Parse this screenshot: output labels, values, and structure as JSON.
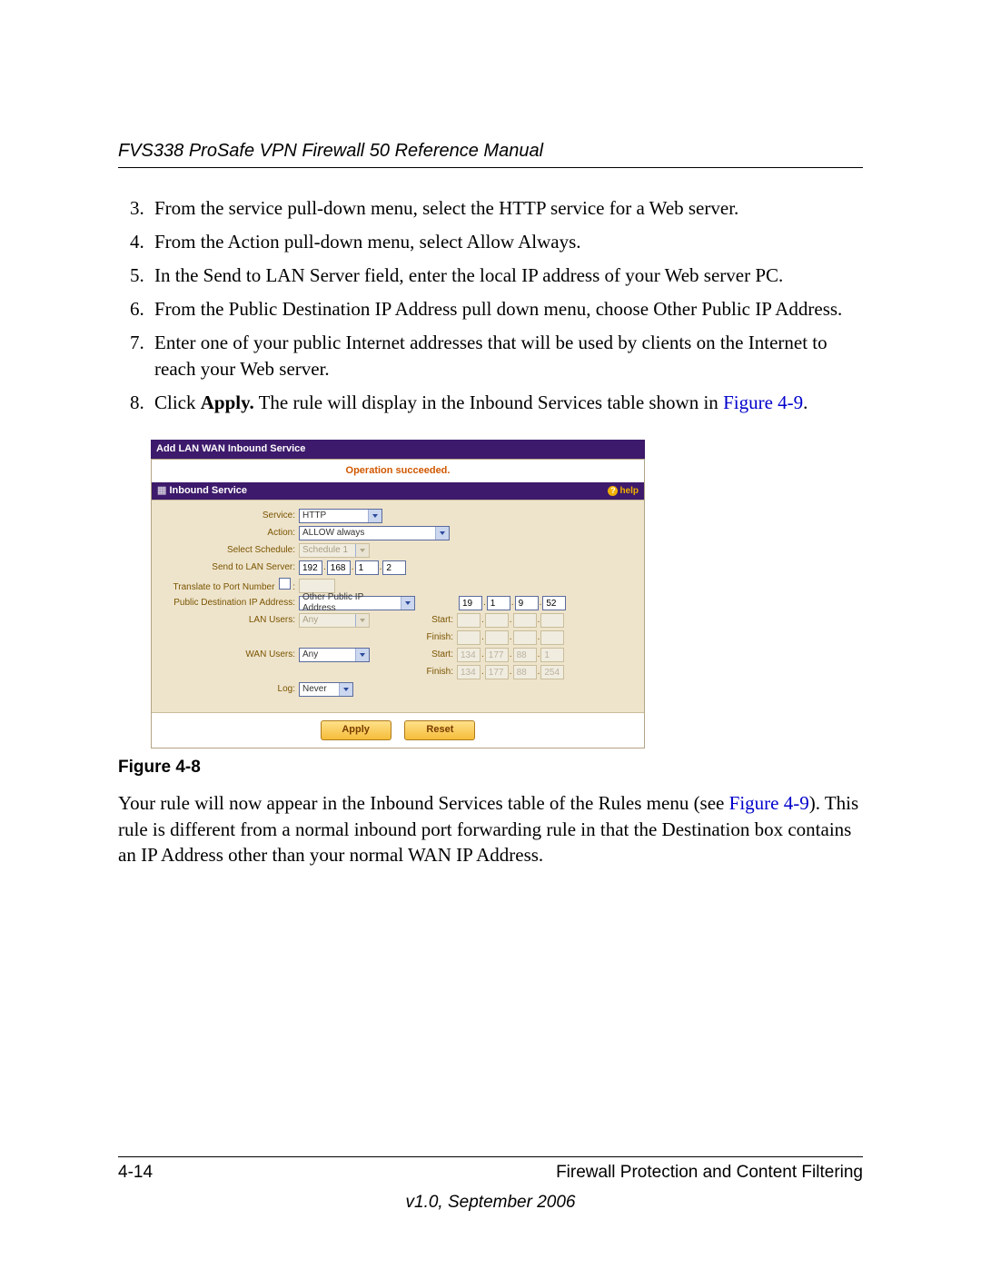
{
  "header": {
    "title": "FVS338 ProSafe VPN Firewall 50 Reference Manual"
  },
  "steps_start": 3,
  "steps": [
    {
      "text": "From the service pull-down menu, select the HTTP service for a Web server."
    },
    {
      "text": "From the Action pull-down menu, select Allow Always."
    },
    {
      "text": "In the Send to LAN Server field, enter the local IP address of your Web server PC."
    },
    {
      "text": "From the Public Destination IP Address pull down menu, choose Other Public IP Address."
    },
    {
      "text": "Enter one of your public Internet addresses that will be used by clients on the Internet to reach your Web server."
    },
    {
      "pre": "Click ",
      "bold": "Apply.",
      "post": " The rule will display in the Inbound Services table shown in ",
      "link": "Figure 4-9",
      "post2": "."
    }
  ],
  "panel": {
    "title": "Add LAN WAN Inbound Service",
    "success": "Operation succeeded.",
    "section": "Inbound Service",
    "help": "help",
    "labels": {
      "service": "Service:",
      "action": "Action:",
      "schedule": "Select Schedule:",
      "sendto": "Send to LAN Server:",
      "translate": "Translate to Port Number",
      "pubdest": "Public Destination IP Address:",
      "lanusers": "LAN Users:",
      "wanusers": "WAN Users:",
      "log": "Log:",
      "start": "Start:",
      "finish": "Finish:"
    },
    "values": {
      "service": "HTTP",
      "action": "ALLOW always",
      "schedule": "Schedule 1",
      "sendto": [
        "192",
        "168",
        "1",
        "2"
      ],
      "translate": "",
      "pubdest": "Other Public IP Address",
      "pubdest_ip": [
        "19",
        "1",
        "9",
        "52"
      ],
      "lanusers": "Any",
      "lan_start": [
        "",
        "",
        "",
        ""
      ],
      "lan_finish": [
        "",
        "",
        "",
        ""
      ],
      "wanusers": "Any",
      "wan_start": [
        "134",
        "177",
        "88",
        "1"
      ],
      "wan_finish": [
        "134",
        "177",
        "88",
        "254"
      ],
      "log": "Never"
    },
    "buttons": {
      "apply": "Apply",
      "reset": "Reset"
    }
  },
  "figure_caption": "Figure 4-8",
  "para": {
    "pre": "Your rule will now appear in the Inbound Services table of the Rules menu (see ",
    "link": "Figure 4-9",
    "post": "). This rule is different from a normal inbound port forwarding rule in that the Destination box contains an IP Address other than your normal WAN IP Address."
  },
  "footer": {
    "page": "4-14",
    "chapter": "Firewall Protection and Content Filtering",
    "version": "v1.0, September 2006"
  }
}
